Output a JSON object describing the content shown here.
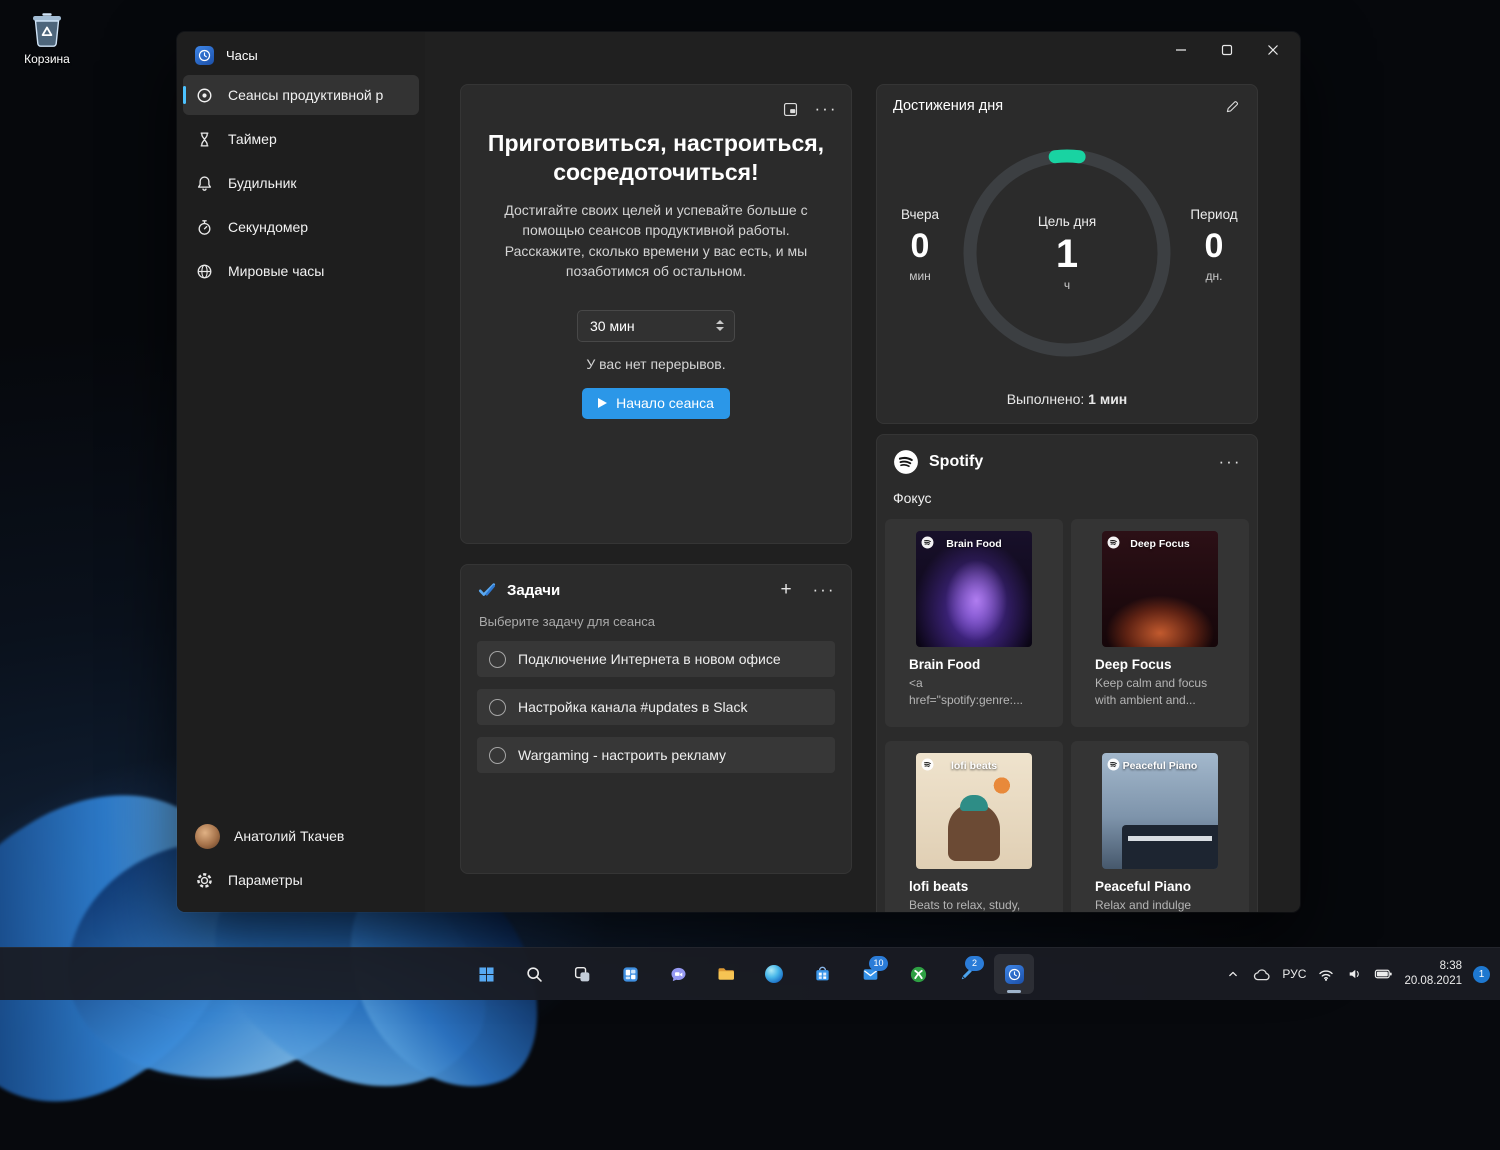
{
  "desktop": {
    "recycle_bin_label": "Корзина"
  },
  "window": {
    "sidebar": {
      "app_title": "Часы",
      "items": [
        {
          "label": "Сеансы продуктивной р",
          "selected": true
        },
        {
          "label": "Таймер",
          "selected": false
        },
        {
          "label": "Будильник",
          "selected": false
        },
        {
          "label": "Секундомер",
          "selected": false
        },
        {
          "label": "Мировые часы",
          "selected": false
        }
      ],
      "user_name": "Анатолий Ткачев",
      "settings_label": "Параметры"
    },
    "focus_card": {
      "title": "Приготовиться, настроиться, сосредоточиться!",
      "description": "Достигайте своих целей и успевайте больше с помощью сеансов продуктивной работы. Расскажите, сколько времени у вас есть, и мы позаботимся об остальном.",
      "duration_value": "30 мин",
      "breaks_note": "У вас нет перерывов.",
      "start_button_label": "Начало сеанса"
    },
    "progress_card": {
      "title": "Достижения дня",
      "yesterday": {
        "label": "Вчера",
        "value": "0",
        "unit": "мин"
      },
      "goal": {
        "label": "Цель дня",
        "value": "1",
        "unit": "ч"
      },
      "period": {
        "label": "Период",
        "value": "0",
        "unit": "дн."
      },
      "completed_label": "Выполнено:",
      "completed_value": "1 мин",
      "accent_color": "#19d3a2"
    },
    "tasks_card": {
      "title": "Задачи",
      "subtitle": "Выберите задачу для сеанса",
      "items": [
        "Подключение Интернета в новом офисе",
        "Настройка канала #updates в Slack",
        "Wargaming - настроить рекламу"
      ]
    },
    "spotify_card": {
      "brand": "Spotify",
      "section_label": "Фокус",
      "playlists": [
        {
          "cover_label": "Brain Food",
          "title": "Brain Food",
          "description": "<a href=\"spotify:genre:..."
        },
        {
          "cover_label": "Deep Focus",
          "title": "Deep Focus",
          "description": "Keep calm and focus with ambient and..."
        },
        {
          "cover_label": "lofi beats",
          "title": "lofi beats",
          "description": "Beats to relax, study,"
        },
        {
          "cover_label": "Peaceful Piano",
          "title": "Peaceful Piano",
          "description": "Relax and indulge"
        }
      ]
    },
    "icons": {
      "more": "···",
      "plus": "+"
    }
  },
  "taskbar": {
    "badge_mail": "10",
    "badge_pen": "2",
    "tray": {
      "language": "РУС",
      "time": "8:38",
      "date": "20.08.2021",
      "notification_count": "1"
    }
  },
  "accent": {
    "button_blue": "#2b97e8",
    "selection_blue": "#4cc2ff"
  }
}
